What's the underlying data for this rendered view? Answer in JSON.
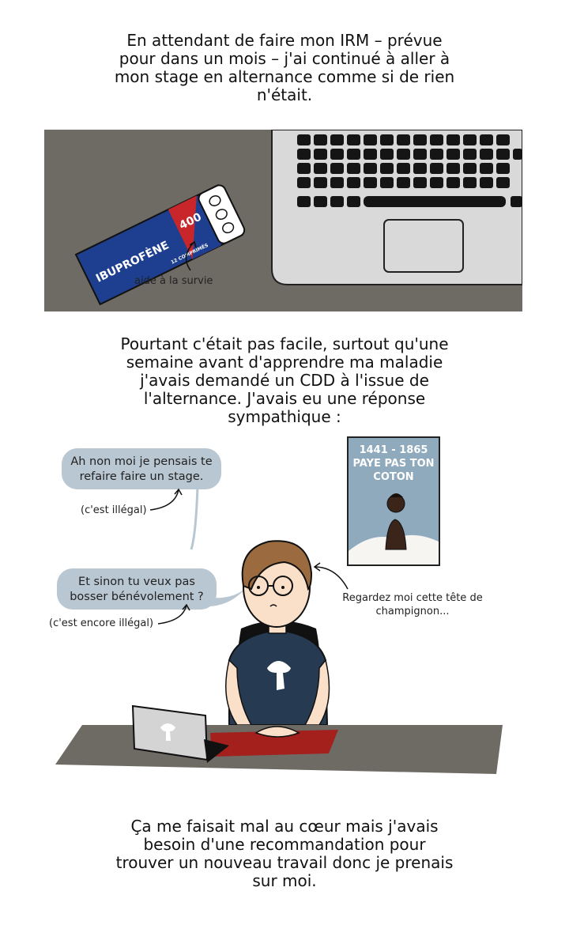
{
  "caption1": [
    "En attendant de faire mon IRM – prévue",
    "pour dans un mois – j'ai continué à aller à",
    "mon stage en alternance comme si de rien",
    "n'était."
  ],
  "pack": {
    "brand": "IBUPROFÈNE",
    "dose": "400",
    "count": "12 COMPRIMÉS"
  },
  "note_pack": "aide à la survie",
  "caption2": [
    "Pourtant c'était pas facile, surtout qu'une",
    "semaine avant d'apprendre ma maladie",
    "j'avais demandé un CDD à l'issue de",
    "l'alternance. J'avais eu une réponse",
    "sympathique :"
  ],
  "poster": {
    "line1": "1441 - 1865",
    "line2": "PAYE PAS TON",
    "line3": "COTON"
  },
  "bubble1": [
    "Ah non moi je pensais te",
    "refaire faire un stage."
  ],
  "note1": "(c'est illégal)",
  "bubble2": [
    "Et sinon tu veux pas",
    "bosser bénévolement ?"
  ],
  "note2": "(c'est encore illégal)",
  "note_self": [
    "Regardez moi cette tête de",
    "champignon..."
  ],
  "caption3": [
    "Ça me faisait mal au cœur mais j'avais",
    "besoin d'une recommandation pour",
    "trouver un nouveau travail donc je prenais",
    "sur moi."
  ],
  "colors": {
    "desk": "#6e6a64",
    "laptop": "#d8d8d8",
    "pack_blue": "#1e3f8f",
    "pack_red": "#c8262a",
    "bubble": "#b9c7d2",
    "poster_sky": "#8fa9bd",
    "shirt": "#263a52",
    "mousepad": "#a3201c"
  }
}
